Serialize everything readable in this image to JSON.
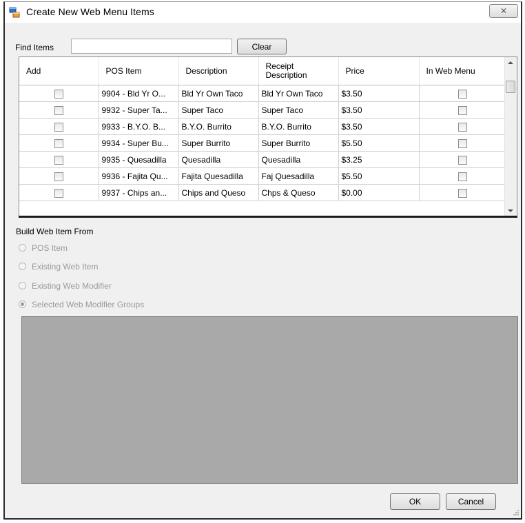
{
  "window": {
    "title": "Create New Web Menu Items",
    "close_label": "⨯"
  },
  "find": {
    "label": "Find Items",
    "value": "",
    "clear_label": "Clear"
  },
  "grid": {
    "headers": {
      "add": "Add",
      "pos_item": "POS Item",
      "description": "Description",
      "receipt_line1": "Receipt",
      "receipt_line2": "Description",
      "price": "Price",
      "in_web_menu": "In Web Menu"
    },
    "rows": [
      {
        "pos": "9904 - Bld Yr O...",
        "desc": "Bld Yr Own Taco",
        "receipt": "Bld Yr Own Taco",
        "price": "$3.50"
      },
      {
        "pos": "9932 - Super Ta...",
        "desc": "Super Taco",
        "receipt": "Super Taco",
        "price": "$3.50"
      },
      {
        "pos": "9933 - B.Y.O. B...",
        "desc": "B.Y.O. Burrito",
        "receipt": "B.Y.O. Burrito",
        "price": "$3.50"
      },
      {
        "pos": "9934 - Super Bu...",
        "desc": "Super Burrito",
        "receipt": "Super Burrito",
        "price": "$5.50"
      },
      {
        "pos": "9935 - Quesadilla",
        "desc": "Quesadilla",
        "receipt": "Quesadilla",
        "price": "$3.25"
      },
      {
        "pos": "9936 - Fajita Qu...",
        "desc": "Fajita Quesadilla",
        "receipt": "Faj Quesadilla",
        "price": "$5.50"
      },
      {
        "pos": "9937 - Chips an...",
        "desc": "Chips and Queso",
        "receipt": "Chps & Queso",
        "price": "$0.00"
      }
    ]
  },
  "build": {
    "label": "Build Web Item From",
    "options": [
      "POS Item",
      "Existing Web Item",
      "Existing Web Modifier",
      "Selected Web Modifier Groups"
    ],
    "selected_index": 3
  },
  "buttons": {
    "ok": "OK",
    "cancel": "Cancel"
  }
}
